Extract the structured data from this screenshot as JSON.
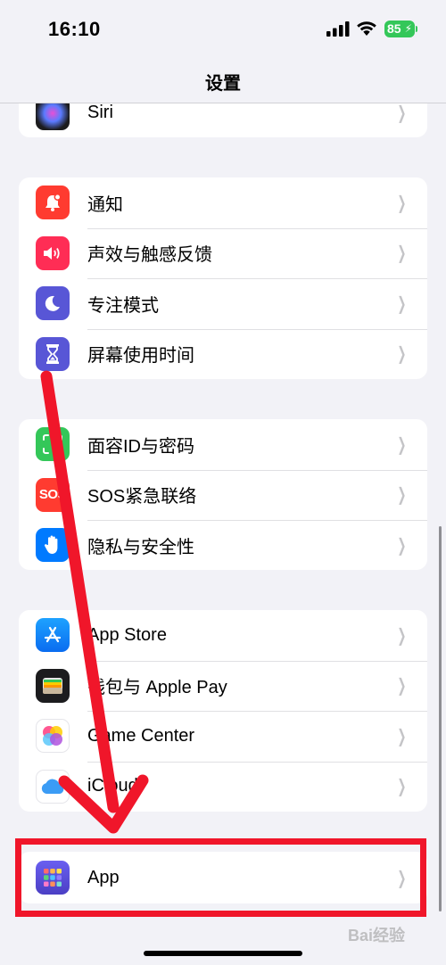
{
  "status_bar": {
    "time": "16:10",
    "battery": "85"
  },
  "nav": {
    "title": "设置"
  },
  "groups": [
    {
      "items": [
        {
          "label": "Siri",
          "icon": "siri-icon",
          "color": "#1c1c1e"
        }
      ]
    },
    {
      "items": [
        {
          "label": "通知",
          "icon": "bell-icon",
          "color": "#ff3b30"
        },
        {
          "label": "声效与触感反馈",
          "icon": "speaker-icon",
          "color": "#ff2d55"
        },
        {
          "label": "专注模式",
          "icon": "moon-icon",
          "color": "#5856d6"
        },
        {
          "label": "屏幕使用时间",
          "icon": "hourglass-icon",
          "color": "#5856d6"
        }
      ]
    },
    {
      "items": [
        {
          "label": "面容ID与密码",
          "icon": "face-id-icon",
          "color": "#34c759"
        },
        {
          "label": "SOS紧急联络",
          "icon": "sos-icon",
          "color": "#ff3b30",
          "icon_text": "SOS"
        },
        {
          "label": "隐私与安全性",
          "icon": "hand-icon",
          "color": "#007aff"
        }
      ]
    },
    {
      "items": [
        {
          "label": "App Store",
          "icon": "app-store-icon",
          "color": "#0a84ff"
        },
        {
          "label": "钱包与 Apple Pay",
          "icon": "wallet-icon",
          "color": "#1c1c1e"
        },
        {
          "label": "Game Center",
          "icon": "game-center-icon",
          "color": "#ffffff"
        },
        {
          "label": "iCloud",
          "icon": "icloud-icon",
          "color": "#ffffff"
        }
      ]
    },
    {
      "items": [
        {
          "label": "App",
          "icon": "apps-grid-icon",
          "color": "#5e5ce6"
        }
      ]
    }
  ],
  "watermark": "Bai经验",
  "annotation_color": "#f0162a"
}
